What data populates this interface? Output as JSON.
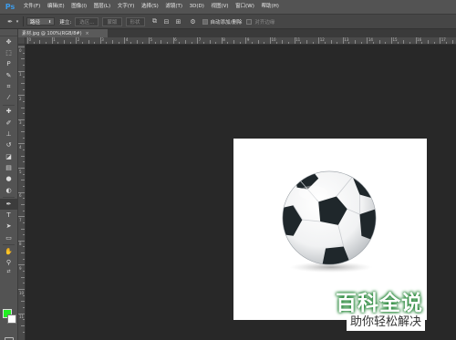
{
  "app": {
    "logo": "Ps"
  },
  "menu": {
    "items": [
      "文件(F)",
      "编辑(E)",
      "图像(I)",
      "图层(L)",
      "文字(Y)",
      "选择(S)",
      "滤镜(T)",
      "3D(D)",
      "视图(V)",
      "窗口(W)",
      "帮助(H)"
    ]
  },
  "options": {
    "path_mode": "路径",
    "make_label": "建立:",
    "selection_button": "选区...",
    "mask_button": "蒙版",
    "shape_button": "形状",
    "auto_add_delete": "自动添加/删除",
    "align_edges": "对齐边缘"
  },
  "document": {
    "tab_label": "素材.jpg @ 100%(RGB/8#)",
    "close_glyph": "×"
  },
  "ruler": {
    "top_numbers": [
      "0",
      "1",
      "2",
      "3",
      "4",
      "5",
      "6",
      "7",
      "8",
      "9",
      "10",
      "11",
      "12",
      "13",
      "14",
      "15",
      "16",
      "17"
    ],
    "left_numbers": [
      "0",
      "1",
      "2",
      "3",
      "4",
      "5",
      "6",
      "7",
      "8",
      "9",
      "10",
      "11"
    ]
  },
  "colors": {
    "foreground": "#22ee22",
    "background": "#ffffff",
    "canvas_bg": "#282828",
    "accent": "#3d9be9"
  },
  "tools": [
    "move-icon",
    "marquee-icon",
    "lasso-icon",
    "quick-select-icon",
    "crop-icon",
    "eyedropper-icon",
    "healing-icon",
    "brush-icon",
    "clone-stamp-icon",
    "history-brush-icon",
    "eraser-icon",
    "gradient-icon",
    "blur-icon",
    "dodge-icon",
    "pen-icon",
    "type-icon",
    "path-select-icon",
    "shape-icon",
    "hand-icon",
    "zoom-icon"
  ],
  "watermark": {
    "title": "百科全说",
    "subtitle": "助你轻松解决"
  }
}
